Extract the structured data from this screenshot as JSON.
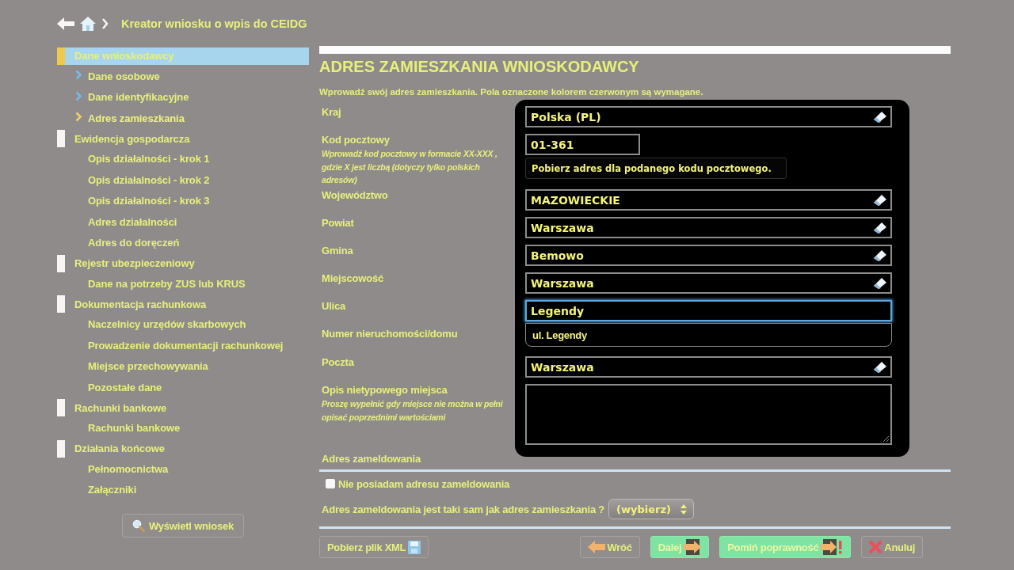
{
  "header": {
    "title": "Kreator wniosku o wpis do CEIDG"
  },
  "sidebar": {
    "groups": [
      {
        "label": "Dane wnioskodawcy",
        "selected": true,
        "children": [
          {
            "label": "Dane osobowe",
            "selected": false,
            "completed": true
          },
          {
            "label": "Dane identyfikacyjne",
            "selected": false,
            "completed": true
          },
          {
            "label": "Adres zamieszkania",
            "selected": true,
            "completed": false
          }
        ]
      },
      {
        "label": "Ewidencja gospodarcza",
        "selected": false,
        "children": [
          {
            "label": "Opis działalności - krok 1",
            "selected": false,
            "completed": false
          },
          {
            "label": "Opis działalności - krok 2",
            "selected": false,
            "completed": false
          },
          {
            "label": "Opis działalności - krok 3",
            "selected": false,
            "completed": false
          },
          {
            "label": "Adres działalności",
            "selected": false,
            "completed": false
          },
          {
            "label": "Adres do doręczeń",
            "selected": false,
            "completed": false
          }
        ]
      },
      {
        "label": "Rejestr ubezpieczeniowy",
        "selected": false,
        "children": [
          {
            "label": "Dane na potrzeby ZUS lub KRUS",
            "selected": false,
            "completed": false
          }
        ]
      },
      {
        "label": "Dokumentacja rachunkowa",
        "selected": false,
        "children": [
          {
            "label": "Naczelnicy urzędów skarbowych",
            "selected": false,
            "completed": false
          },
          {
            "label": "Prowadzenie dokumentacji rachunkowej",
            "selected": false,
            "completed": false
          },
          {
            "label": "Miejsce przechowywania",
            "selected": false,
            "completed": false
          },
          {
            "label": "Pozostałe dane",
            "selected": false,
            "completed": false
          }
        ]
      },
      {
        "label": "Rachunki bankowe",
        "selected": false,
        "children": [
          {
            "label": "Rachunki bankowe",
            "selected": false,
            "completed": false
          }
        ]
      },
      {
        "label": "Działania końcowe",
        "selected": false,
        "children": [
          {
            "label": "Pełnomocnictwa",
            "selected": false,
            "completed": false
          },
          {
            "label": "Załączniki",
            "selected": false,
            "completed": false
          }
        ]
      }
    ],
    "button": "Wyświetl wniosek"
  },
  "form": {
    "title": "ADRES ZAMIESZKANIA WNIOSKODAWCY",
    "intro": "Wprowadź swój adres zamieszkania. Pola oznaczone kolorem czerwonym są wymagane.",
    "rows": [
      {
        "label": "Kraj",
        "field": {
          "kind": "pick",
          "value": "Polska (PL)",
          "focused": false
        }
      },
      {
        "label": "Kod pocztowy",
        "hint": "Wprowadź kod pocztowy w formacie XX-XXX , gdzie X jest liczbą (dotyczy tylko polskich adresów)",
        "field": {
          "kind": "short",
          "value": "01-361",
          "focused": false
        },
        "action": "Pobierz adres dla podanego kodu pocztowego."
      },
      {
        "label": "Województwo",
        "field": {
          "kind": "pick",
          "value": "MAZOWIECKIE",
          "focused": false
        }
      },
      {
        "label": "Powiat",
        "field": {
          "kind": "pick",
          "value": "Warszawa",
          "focused": false
        }
      },
      {
        "label": "Gmina",
        "field": {
          "kind": "pick",
          "value": "Bemowo",
          "focused": false
        }
      },
      {
        "label": "Miejscowość",
        "field": {
          "kind": "pick",
          "value": "Warszawa",
          "focused": false
        }
      },
      {
        "label": "Ulica",
        "field": {
          "kind": "text",
          "value": "Legendy",
          "focused": true
        },
        "suggestions": [
          "ul. Legendy"
        ]
      },
      {
        "label": "Numer nieruchomości/domu"
      },
      {
        "label": "Poczta",
        "field": {
          "kind": "pick",
          "value": "Warszawa",
          "focused": false
        }
      },
      {
        "label": "Opis nietypowego miejsca",
        "hint": "Proszę wypełnić gdy miejsce nie można w pełni opisać poprzednimi wartościami",
        "field": {
          "kind": "textarea",
          "focused": false
        }
      }
    ]
  },
  "registration": {
    "title": "Adres zameldowania",
    "no_address": {
      "label": "Nie posiadam adresu zameldowania",
      "checked": false
    },
    "same_question": "Adres zameldowania jest taki sam jak adres zamieszkania ?",
    "same_select": {
      "value": "(wybierz)"
    }
  },
  "footer": {
    "buttons": [
      {
        "kind": "xml",
        "label": "Pobierz plik XML"
      },
      {
        "kind": "back",
        "label": "Wróć"
      },
      {
        "kind": "next",
        "label": "Dalej"
      },
      {
        "kind": "skip",
        "label": "Pomiń poprawność"
      },
      {
        "kind": "cancel",
        "label": "Anuluj"
      }
    ]
  }
}
